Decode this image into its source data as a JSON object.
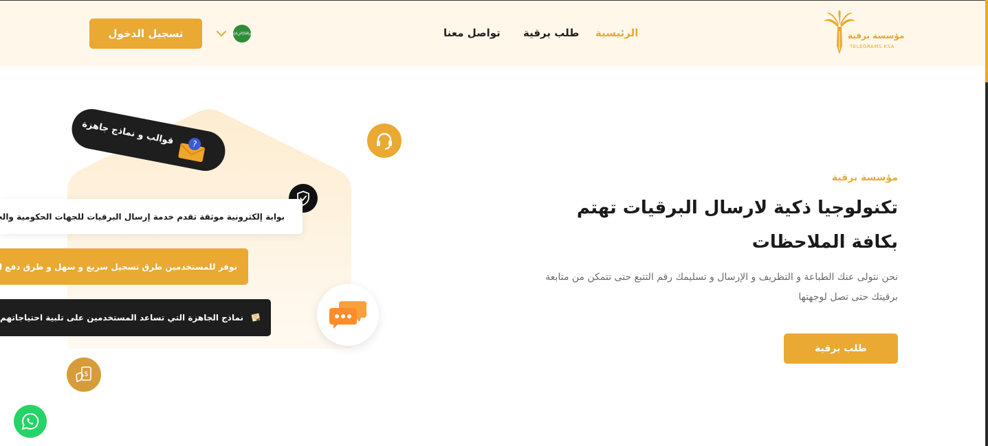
{
  "header": {
    "logo_text": "مؤسسة برقية",
    "logo_sub": "TELEGRAMS KSA",
    "nav": [
      {
        "label": "الرئيسية"
      },
      {
        "label": "طلب برقية"
      },
      {
        "label": "تواصل معنا"
      }
    ],
    "login_label": "تسجيل الدخول",
    "language_flag_icon": "saudi-flag-icon"
  },
  "hero": {
    "eyebrow": "مؤسسة برقية",
    "title": "تكنولوجيا ذكية لارسال البرقيات تهتم بكافة الملاحظات",
    "description": "نحن نتولى عنك الطباعة و التظريف و الإرسال و تسليمك رقم التتبع حتى تتمكن من متابعة برقيتك حتى تصل لوجهتها",
    "cta_label": "طلب برقية"
  },
  "illustration": {
    "pill_text": "قوالب و نماذج جاهزة",
    "card1_text": "بوابة إلكترونية موثقة تقدم خدمة إرسال البرقيات للجهات الحكومية والخاصة",
    "card2_text": "نوفر للمستخدمين طرق تسجيل سريع و سهل و طرق دفع امنه",
    "card3_text": "نماذج الجاهزة التي تساعد المستخدمين على تلبية احتياجاتهم"
  },
  "colors": {
    "accent": "#e9a933",
    "header_bg": "#fff8ea",
    "dark": "#1e1e1e",
    "whatsapp": "#25d366"
  }
}
